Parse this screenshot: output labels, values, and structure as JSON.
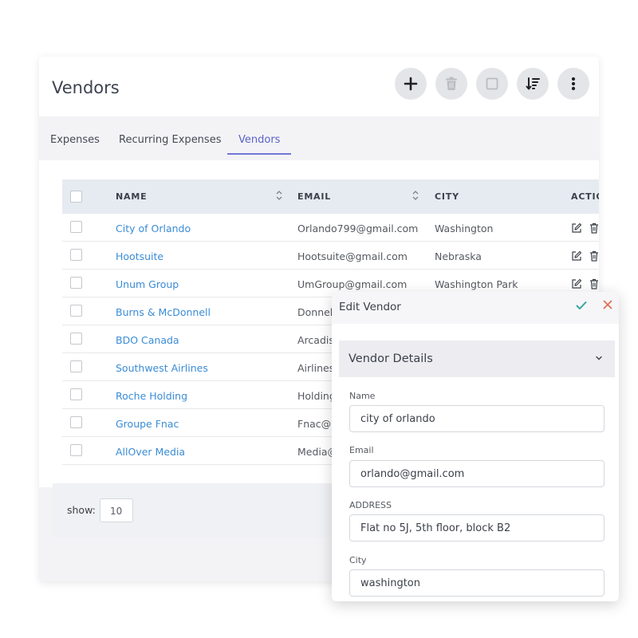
{
  "page": {
    "title": "Vendors"
  },
  "toolbar": {
    "buttons": [
      {
        "icon": "plus-icon"
      },
      {
        "icon": "trash-icon"
      },
      {
        "icon": "square-icon"
      },
      {
        "icon": "sort-icon"
      },
      {
        "icon": "more-vertical-icon"
      }
    ]
  },
  "tabs": [
    {
      "label": "Expenses",
      "active": false
    },
    {
      "label": "Recurring Expenses",
      "active": false
    },
    {
      "label": "Vendors",
      "active": true
    }
  ],
  "table": {
    "columns": [
      "NAME",
      "EMAIL",
      "CITY",
      "ACTIO"
    ],
    "rows": [
      {
        "name": "City of Orlando",
        "email": "Orlando799@gmail.com",
        "city": "Washington",
        "actions": true
      },
      {
        "name": "Hootsuite",
        "email": "Hootsuite@gmail.com",
        "city": "Nebraska",
        "actions": true
      },
      {
        "name": "Unum Group",
        "email": "UmGroup@gmail.com",
        "city": "Washington Park",
        "actions": true
      },
      {
        "name": "Burns & McDonnell",
        "email": "Donnel",
        "city": "",
        "actions": false
      },
      {
        "name": "BDO Canada",
        "email": "Arcadis",
        "city": "",
        "actions": false
      },
      {
        "name": "Southwest Airlines",
        "email": "Airlines",
        "city": "",
        "actions": false
      },
      {
        "name": "Roche Holding",
        "email": "Holding",
        "city": "",
        "actions": false
      },
      {
        "name": "Groupe Fnac",
        "email": "Fnac@",
        "city": "",
        "actions": false
      },
      {
        "name": "AllOver Media",
        "email": "Media@",
        "city": "",
        "actions": false
      }
    ]
  },
  "pagination": {
    "show_label": "show:",
    "page_size": "10"
  },
  "edit_panel": {
    "title": "Edit Vendor",
    "section_title": "Vendor Details",
    "fields": [
      {
        "label": "Name",
        "value": "city of orlando"
      },
      {
        "label": "Email",
        "value": "orlando@gmail.com"
      },
      {
        "label": "ADDRESS",
        "value": "Flat no 5J, 5th floor, block B2"
      },
      {
        "label": "City",
        "value": "washington"
      }
    ]
  },
  "colors": {
    "accent": "#5a62c8",
    "link": "#3a8cd6",
    "confirm": "#3aa6a0",
    "cancel": "#e0684a"
  }
}
